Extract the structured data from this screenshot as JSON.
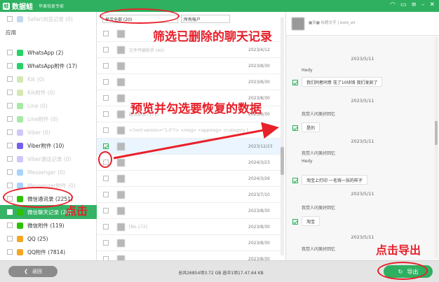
{
  "titlebar": {
    "app_name": "数据蛙",
    "subtitle": "苹果恢复专家"
  },
  "sidebar": {
    "top_item": "Safari浏览记录 (0)",
    "section_label": "应用",
    "items": [
      {
        "label": "WhatsApp (2)",
        "dim": false,
        "color": "#25d366"
      },
      {
        "label": "WhatsApp附件 (17)",
        "dim": false,
        "color": "#25d366"
      },
      {
        "label": "Kik (0)",
        "dim": true,
        "color": "#82bc23"
      },
      {
        "label": "Kik附件 (0)",
        "dim": true,
        "color": "#82bc23"
      },
      {
        "label": "Line (0)",
        "dim": true,
        "color": "#00c300"
      },
      {
        "label": "Line附件 (0)",
        "dim": true,
        "color": "#00c300"
      },
      {
        "label": "Viber (0)",
        "dim": true,
        "color": "#7360f2"
      },
      {
        "label": "Viber附件 (10)",
        "dim": false,
        "color": "#7360f2"
      },
      {
        "label": "Viber通话记录 (0)",
        "dim": true,
        "color": "#7360f2"
      },
      {
        "label": "Messenger (0)",
        "dim": true,
        "color": "#0084ff"
      },
      {
        "label": "Messenger附件 (0)",
        "dim": true,
        "color": "#0084ff"
      },
      {
        "label": "微信通讯录 (2251)",
        "dim": false,
        "color": "#2dc100"
      },
      {
        "label": "微信聊天记录 (20)",
        "dim": false,
        "active": true,
        "color": "#2dc100"
      },
      {
        "label": "微信附件 (119)",
        "dim": false,
        "color": "#2dc100"
      },
      {
        "label": "QQ (25)",
        "dim": false,
        "color": "#f5a623"
      },
      {
        "label": "QQ附件 (7814)",
        "dim": false,
        "color": "#f5a623"
      },
      {
        "label": "应用文档 (216)",
        "dim": false,
        "color": "#4a90d9"
      }
    ]
  },
  "filters": {
    "show": "显示全部 (20)",
    "account": "所有帐户"
  },
  "list": [
    {
      "title": "",
      "date": ""
    },
    {
      "title": "文件传输助手 (40)",
      "date": "2023/4/12"
    },
    {
      "title": "",
      "date": "2023/8/30"
    },
    {
      "title": "",
      "date": "2023/8/30"
    },
    {
      "title": "",
      "date": "2023/8/30"
    },
    {
      "title": "腾讯新闻 (173)",
      "date": "2023/8/30"
    },
    {
      "title": "<?xml version=\"1.0\"?> <msg> <appmsg> <category type=\"20\"",
      "date": ""
    },
    {
      "title": "",
      "date": "2023/12/23",
      "selected": true
    },
    {
      "title": "",
      "date": "2024/3/23"
    },
    {
      "title": "",
      "date": "2024/3/26"
    },
    {
      "title": "",
      "date": "2023/7/10"
    },
    {
      "title": "",
      "date": "2023/8/30"
    },
    {
      "title": "[No.172]",
      "date": "2023/8/30"
    },
    {
      "title": "",
      "date": "2023/8/30"
    },
    {
      "title": "",
      "date": "2023/8/30"
    }
  ],
  "chat": {
    "header": "■张■ 标题文字 | bold_alt",
    "date1": "2023/5/11",
    "sender1": "Hedy",
    "msg1": "我们同者同意 花了10块钱 我们发刻了",
    "date2": "2023/5/11",
    "sys1": "我觉人问美好回忆",
    "msg2": "是的",
    "date3": "2023/5/11",
    "sys2": "我觉人问美好回忆",
    "sender2": "Hedy",
    "msg3": "淘宝上打印 一毛钱一张的样子",
    "date4": "2023/5/11",
    "sys3": "我觉人问美好回忆",
    "msg4": "淘宝",
    "date5": "2023/5/11",
    "sys4": "我觉人问美好回忆"
  },
  "bottombar": {
    "back_label": "返回",
    "status": "总共26854项3.72 GB 选中1项17.47.64 KB",
    "export_label": "导出"
  },
  "annotations": {
    "filter_tip": "筛选已删除的聊天记录",
    "preview_tip": "预览并勾选要恢复的数据",
    "click_tip": "点击",
    "export_tip": "点击导出",
    "color": "#e8202a"
  }
}
